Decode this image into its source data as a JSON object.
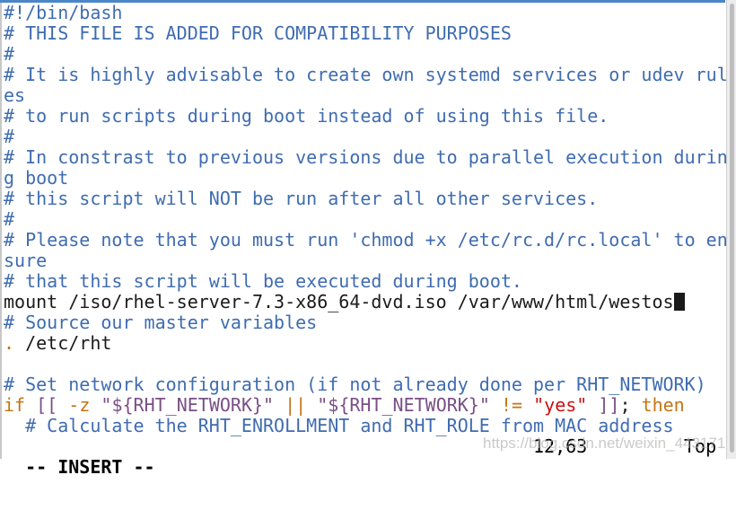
{
  "colors": {
    "comment": "#3f6cb0",
    "keyword": "#c47412",
    "string": "#7a4f86",
    "literal": "#d01010",
    "topbar": "#4a86c8"
  },
  "rows": [
    [
      {
        "t": "#!/bin/bash",
        "c": "comment"
      }
    ],
    [
      {
        "t": "# THIS FILE IS ADDED FOR COMPATIBILITY PURPOSES",
        "c": "comment"
      }
    ],
    [
      {
        "t": "#",
        "c": "comment"
      }
    ],
    [
      {
        "t": "# It is highly advisable to create own systemd services or udev rul",
        "c": "comment"
      }
    ],
    [
      {
        "t": "es",
        "c": "comment"
      }
    ],
    [
      {
        "t": "# to run scripts during boot instead of using this file.",
        "c": "comment"
      }
    ],
    [
      {
        "t": "#",
        "c": "comment"
      }
    ],
    [
      {
        "t": "# In constrast to previous versions due to parallel execution durin",
        "c": "comment"
      }
    ],
    [
      {
        "t": "g boot",
        "c": "comment"
      }
    ],
    [
      {
        "t": "# this script will NOT be run after all other services.",
        "c": "comment"
      }
    ],
    [
      {
        "t": "#",
        "c": "comment"
      }
    ],
    [
      {
        "t": "# Please note that you must run 'chmod +x /etc/rc.d/rc.local' to en",
        "c": "comment"
      }
    ],
    [
      {
        "t": "sure",
        "c": "comment"
      }
    ],
    [
      {
        "t": "# that this script will be executed during boot.",
        "c": "comment"
      }
    ],
    [
      {
        "t": "mount /iso/rhel-server-7.3-x86_64-dvd.iso /var/www/html/westos",
        "c": "normal"
      }
    ],
    [
      {
        "t": "# Source our master variables",
        "c": "comment"
      }
    ],
    [
      {
        "t": ".",
        "c": "kw"
      },
      {
        "t": " /etc/rht",
        "c": "normal"
      }
    ],
    [],
    [
      {
        "t": "# Set network configuration (if not already done per RHT_NETWORK)",
        "c": "comment"
      }
    ],
    [
      {
        "t": "if",
        "c": "kw"
      },
      {
        "t": " ",
        "c": "normal"
      },
      {
        "t": "[[",
        "c": "str"
      },
      {
        "t": " ",
        "c": "normal"
      },
      {
        "t": "-z",
        "c": "kw"
      },
      {
        "t": " ",
        "c": "normal"
      },
      {
        "t": "\"${RHT_NETWORK}\"",
        "c": "str"
      },
      {
        "t": " ",
        "c": "normal"
      },
      {
        "t": "||",
        "c": "kw"
      },
      {
        "t": " ",
        "c": "normal"
      },
      {
        "t": "\"${RHT_NETWORK}\"",
        "c": "str"
      },
      {
        "t": " ",
        "c": "normal"
      },
      {
        "t": "!=",
        "c": "kw"
      },
      {
        "t": " ",
        "c": "normal"
      },
      {
        "t": "\"yes\"",
        "c": "red"
      },
      {
        "t": " ",
        "c": "normal"
      },
      {
        "t": "]]",
        "c": "str"
      },
      {
        "t": "; ",
        "c": "normal"
      },
      {
        "t": "then",
        "c": "kw"
      }
    ],
    [
      {
        "t": "  # Calculate the RHT_ENROLLMENT and RHT_ROLE from MAC address",
        "c": "comment"
      }
    ]
  ],
  "cursor_row": 14,
  "status": {
    "mode": "-- INSERT --",
    "position": "12,63",
    "scroll": "Top"
  },
  "watermark": "https://blog.csdn.net/weixin_44317199"
}
